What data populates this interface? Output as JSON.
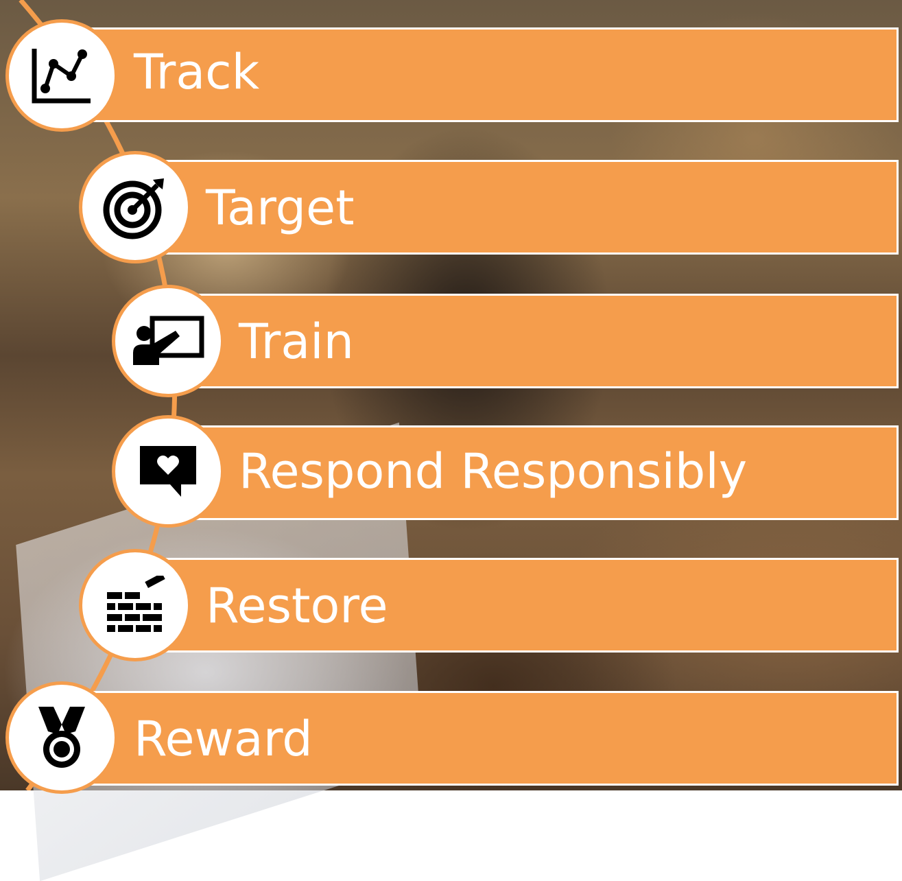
{
  "colors": {
    "accent": "#f59d4c",
    "icon": "#000000",
    "text": "#ffffff"
  },
  "steps": [
    {
      "label": "Track",
      "icon": "line-chart-icon"
    },
    {
      "label": "Target",
      "icon": "target-icon"
    },
    {
      "label": "Train",
      "icon": "presentation-icon"
    },
    {
      "label": "Respond Responsibly",
      "icon": "heart-message-icon"
    },
    {
      "label": "Restore",
      "icon": "brick-wall-icon"
    },
    {
      "label": "Reward",
      "icon": "medal-icon"
    }
  ]
}
